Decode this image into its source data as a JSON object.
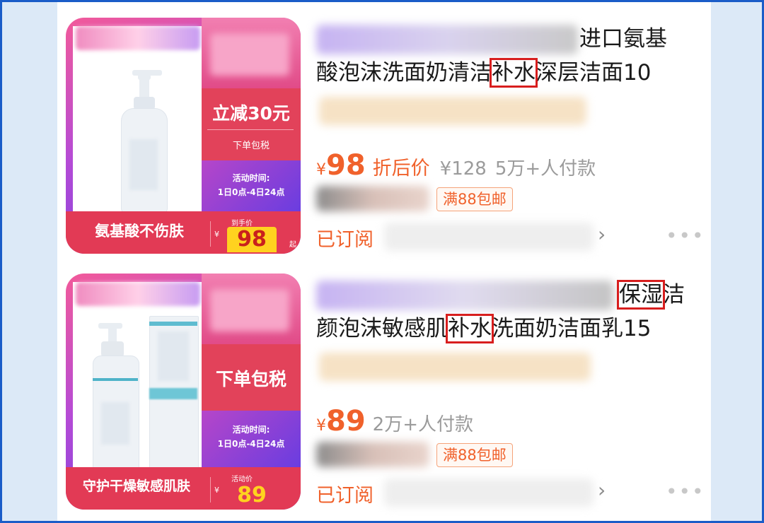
{
  "products": [
    {
      "image": {
        "side_big": "立减30元",
        "side_small": "下单包税",
        "event_line1": "活动时间:",
        "event_line2": "1日0点-4日24点",
        "slogan": "氨基酸不伤肤",
        "price_caption": "到手价",
        "yen": "¥",
        "price": "98",
        "suffix": "起"
      },
      "title_line1": "进口氨基",
      "title_line2_pre": "酸泡沫洗面奶清洁",
      "title_line2_box": "补水",
      "title_line2_post": "深层洁面10",
      "yen": "¥",
      "price": "98",
      "after_label": "折后价",
      "orig_price": "¥128",
      "sold": "5万+人付款",
      "shipping": "满88包邮",
      "subscribed": "已订阅",
      "chevron": "›",
      "more": "•••"
    },
    {
      "image": {
        "side_big": "下单包税",
        "event_line1": "活动时间:",
        "event_line2": "1日0点-4日24点",
        "slogan": "守护干燥敏感肌肤",
        "price_caption": "活动价",
        "yen": "¥",
        "price": "89"
      },
      "title_line1_box": "保湿",
      "title_line1_post": "洁",
      "title_line2_pre": "颜泡沫敏感肌",
      "title_line2_box": "补水",
      "title_line2_post": "洗面奶洁面乳15",
      "yen": "¥",
      "price": "89",
      "sold": "2万+人付款",
      "shipping": "满88包邮",
      "subscribed": "已订阅",
      "chevron": "›",
      "more": "•••"
    }
  ],
  "colors": {
    "accent_orange": "#f0612b",
    "highlight_box": "#d81e1e",
    "frame_border": "#1a5cc8",
    "backdrop": "#dce9f7"
  }
}
